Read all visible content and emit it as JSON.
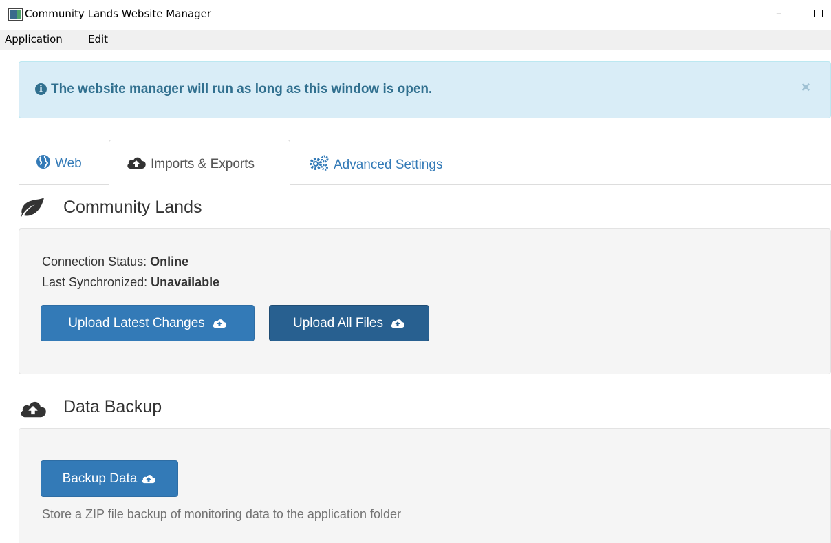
{
  "window": {
    "title": "Community Lands Website Manager",
    "minimize_glyph": "–"
  },
  "menu": {
    "items": [
      "Application",
      "Edit"
    ]
  },
  "alert": {
    "info_glyph": "i",
    "message": "The website manager will run as long as this window is open.",
    "close_glyph": "×"
  },
  "tabs": [
    {
      "label": "Web",
      "icon": "globe-icon"
    },
    {
      "label": "Imports & Exports",
      "icon": "cloud-upload-icon",
      "active": true
    },
    {
      "label": "Advanced Settings",
      "icon": "cogs-icon"
    }
  ],
  "community_lands": {
    "title": "Community Lands",
    "icon": "leaf-icon",
    "connection_label": "Connection Status:",
    "connection_value": "Online",
    "sync_label": "Last Synchronized:",
    "sync_value": "Unavailable",
    "upload_latest_label": "Upload Latest Changes",
    "upload_all_label": "Upload All Files"
  },
  "data_backup": {
    "title": "Data Backup",
    "icon": "cloud-upload-icon",
    "backup_label": "Backup Data",
    "help": "Store a ZIP file backup of monitoring data to the application folder"
  },
  "colors": {
    "alert_bg": "#d9edf7",
    "alert_text": "#31708f",
    "link": "#337ab7",
    "btn_primary": "#337ab7",
    "btn_dark": "#286090"
  }
}
